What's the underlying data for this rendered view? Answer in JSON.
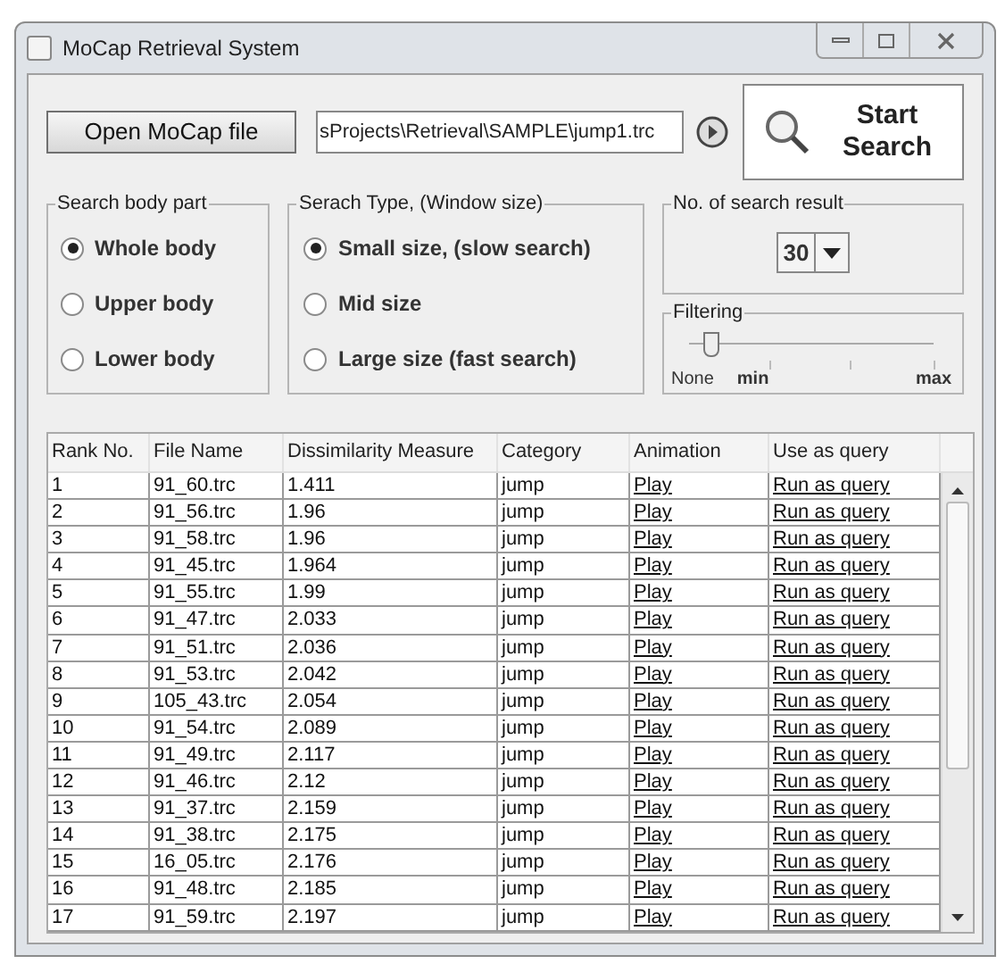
{
  "window": {
    "title": "MoCap Retrieval System"
  },
  "open_button": "Open MoCap file",
  "file_path": {
    "value": "sProjects\\Retrieval\\SAMPLE\\jump1.trc"
  },
  "search_button": {
    "line1": "Start",
    "line2": "Search"
  },
  "body_part": {
    "title": "Search body part",
    "options": [
      {
        "label": "Whole body",
        "selected": true
      },
      {
        "label": "Upper body",
        "selected": false
      },
      {
        "label": "Lower body",
        "selected": false
      }
    ]
  },
  "search_type": {
    "title": "Serach Type, (Window size)",
    "options": [
      {
        "label": "Small size, (slow search)",
        "selected": true
      },
      {
        "label": "Mid size",
        "selected": false
      },
      {
        "label": "Large size (fast search)",
        "selected": false
      }
    ]
  },
  "result_count": {
    "title": "No. of search result",
    "value": "30"
  },
  "filtering": {
    "title": "Filtering",
    "level": 0.09,
    "labels": [
      "None",
      "min",
      "max"
    ]
  },
  "table": {
    "columns": [
      "Rank No.",
      "File Name",
      "Dissimilarity Measure",
      "Category",
      "Animation",
      "Use as query"
    ],
    "rows": [
      [
        "1",
        "91_60.trc",
        "1.411",
        "jump",
        "Play",
        "Run as query"
      ],
      [
        "2",
        "91_56.trc",
        "1.96",
        "jump",
        "Play",
        "Run as query"
      ],
      [
        "3",
        "91_58.trc",
        "1.96",
        "jump",
        "Play",
        "Run as query"
      ],
      [
        "4",
        "91_45.trc",
        "1.964",
        "jump",
        "Play",
        "Run as query"
      ],
      [
        "5",
        "91_55.trc",
        "1.99",
        "jump",
        "Play",
        "Run as query"
      ],
      [
        "6",
        "91_47.trc",
        "2.033",
        "jump",
        "Play",
        "Run as query"
      ],
      [
        "7",
        "91_51.trc",
        "2.036",
        "jump",
        "Play",
        "Run as query"
      ],
      [
        "8",
        "91_53.trc",
        "2.042",
        "jump",
        "Play",
        "Run as query"
      ],
      [
        "9",
        "105_43.trc",
        "2.054",
        "jump",
        "Play",
        "Run as query"
      ],
      [
        "10",
        "91_54.trc",
        "2.089",
        "jump",
        "Play",
        "Run as query"
      ],
      [
        "11",
        "91_49.trc",
        "2.117",
        "jump",
        "Play",
        "Run as query"
      ],
      [
        "12",
        "91_46.trc",
        "2.12",
        "jump",
        "Play",
        "Run as query"
      ],
      [
        "13",
        "91_37.trc",
        "2.159",
        "jump",
        "Play",
        "Run as query"
      ],
      [
        "14",
        "91_38.trc",
        "2.175",
        "jump",
        "Play",
        "Run as query"
      ],
      [
        "15",
        "16_05.trc",
        "2.176",
        "jump",
        "Play",
        "Run as query"
      ],
      [
        "16",
        "91_48.trc",
        "2.185",
        "jump",
        "Play",
        "Run as query"
      ],
      [
        "17",
        "91_59.trc",
        "2.197",
        "jump",
        "Play",
        "Run as query"
      ]
    ]
  }
}
